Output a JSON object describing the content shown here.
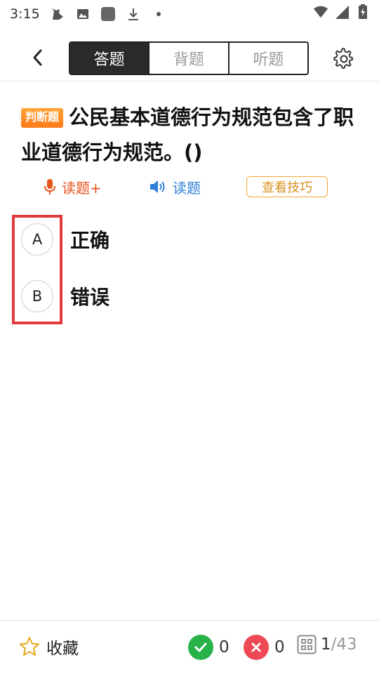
{
  "status_bar": {
    "time": "3:15",
    "icons_left": [
      "cat-icon",
      "image-icon",
      "app-square-icon",
      "download-icon",
      "dot-icon"
    ],
    "icons_right": [
      "wifi-icon",
      "cellular-signal-icon",
      "battery-icon"
    ]
  },
  "header": {
    "back_icon": "chevron-left-icon",
    "tabs": [
      {
        "label": "答题",
        "active": true
      },
      {
        "label": "背题",
        "active": false
      },
      {
        "label": "听题",
        "active": false
      }
    ],
    "settings_icon": "gear-icon"
  },
  "question": {
    "type_badge": "判断题",
    "text": "公民基本道德行为规范包含了职业道德行为规范。()"
  },
  "actions": {
    "read_plus": {
      "label": "读题+",
      "icon": "microphone-icon",
      "color": "#e8541c"
    },
    "read": {
      "label": "读题",
      "icon": "speaker-icon",
      "color": "#2f7fd8"
    },
    "tips": {
      "label": "查看技巧",
      "color": "#f0a530"
    }
  },
  "options": [
    {
      "letter": "A",
      "text": "正确"
    },
    {
      "letter": "B",
      "text": "错误"
    }
  ],
  "bottom_bar": {
    "favorite_label": "收藏",
    "correct_count": "0",
    "wrong_count": "0",
    "progress_current": "1",
    "progress_separator": "/",
    "progress_total": "43"
  },
  "colors": {
    "accent_orange": "#ff7a18",
    "highlight_red": "#e03a3e",
    "correct_green": "#27b24a",
    "wrong_red": "#ee4a55"
  }
}
